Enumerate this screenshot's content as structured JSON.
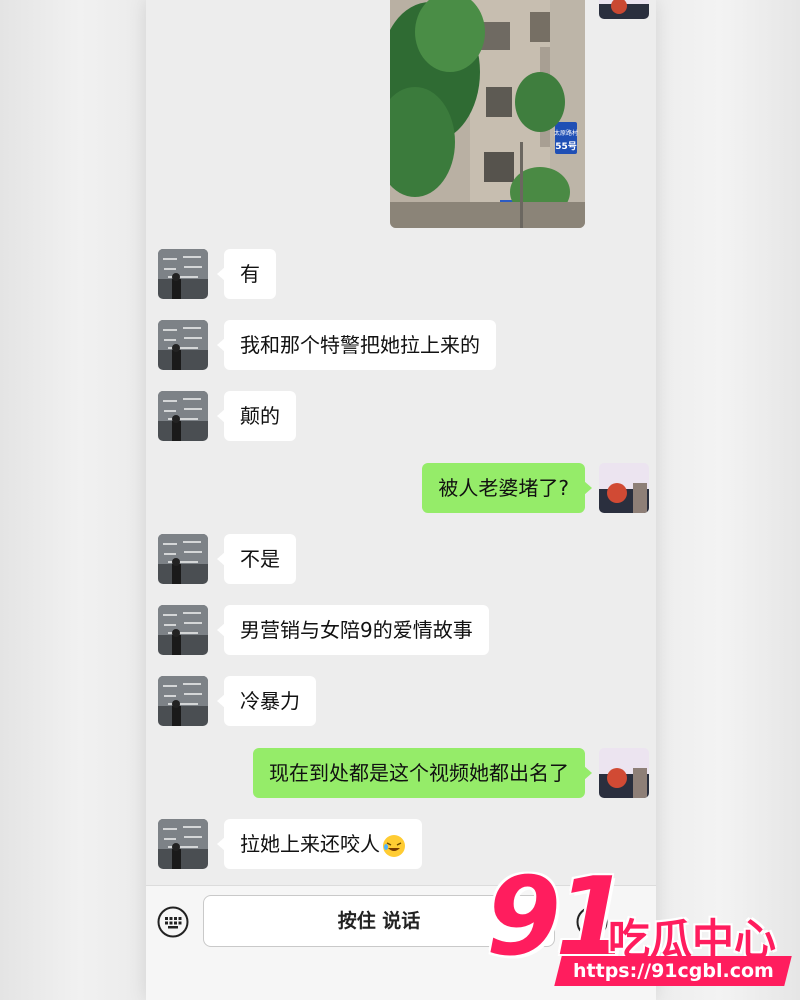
{
  "messages": [
    {
      "side": "in",
      "text": "有"
    },
    {
      "side": "in",
      "text": "我和那个特警把她拉上来的"
    },
    {
      "side": "in",
      "text": "颠的"
    },
    {
      "side": "out",
      "text": "被人老婆堵了?"
    },
    {
      "side": "in",
      "text": "不是"
    },
    {
      "side": "in",
      "text": "男营销与女陪9的爱情故事"
    },
    {
      "side": "in",
      "text": "冷暴力"
    },
    {
      "side": "out",
      "text": "现在到处都是这个视频她都出名了"
    },
    {
      "side": "in",
      "text": "拉她上来还咬人",
      "emoji": "rolling-laughing-emoji"
    }
  ],
  "photo_sign": {
    "line1": "太原路村",
    "line2": "55号"
  },
  "input_bar": {
    "left_icon": "keyboard-icon",
    "voice_label": "按住 说话",
    "right_icon": "emoji-icon"
  },
  "watermark": {
    "number": "91",
    "name": "吃瓜中心",
    "url": "https://91cgbl.com"
  },
  "colors": {
    "outgoing_bubble": "#95ec69",
    "incoming_bubble": "#ffffff",
    "chat_background": "#ededed",
    "watermark": "#ff1d5e"
  }
}
